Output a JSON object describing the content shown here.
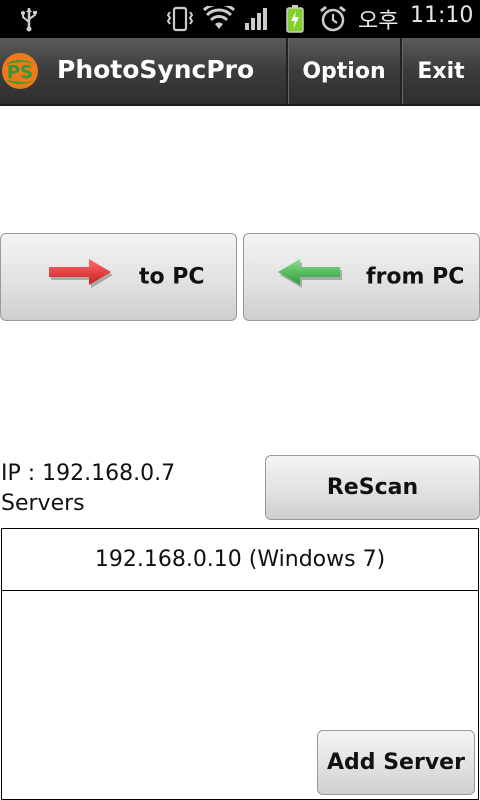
{
  "status_bar": {
    "time": "11:10",
    "ampm": "오후",
    "icons": [
      "usb-icon",
      "vibrate-icon",
      "wifi-icon",
      "signal-icon",
      "battery-charging-icon",
      "alarm-icon"
    ]
  },
  "app_bar": {
    "title": "PhotoSyncPro",
    "logo_text": "PS",
    "option_label": "Option",
    "exit_label": "Exit"
  },
  "transfer": {
    "to_pc_label": "to PC",
    "from_pc_label": "from PC",
    "to_pc_arrow_color": "#e63a3a",
    "from_pc_arrow_color": "#3fae3f"
  },
  "network": {
    "ip_text": "IP : 192.168.0.7",
    "servers_label": "Servers",
    "rescan_label": "ReScan"
  },
  "servers": [
    {
      "label": "192.168.0.10 (Windows 7)"
    }
  ],
  "add_server_label": "Add Server",
  "colors": {
    "logo_orange": "#f07a1a",
    "logo_green": "#2e9a3a",
    "battery_green": "#7fd12a"
  }
}
